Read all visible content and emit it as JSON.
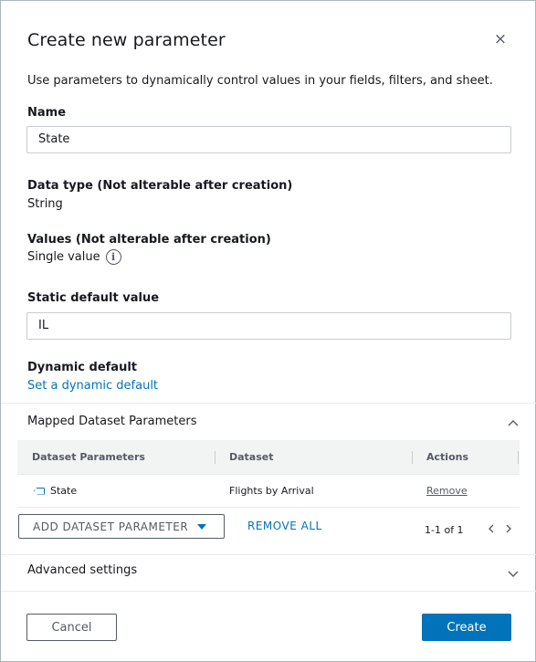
{
  "dialog": {
    "title": "Create new parameter",
    "close_symbol": "×",
    "description": "Use parameters to dynamically control values in your fields, filters, and sheet."
  },
  "name": {
    "label": "Name",
    "value": "State"
  },
  "data_type": {
    "label": "Data type (Not alterable after creation)",
    "value": "String"
  },
  "values": {
    "label": "Values (Not alterable after creation)",
    "value": "Single value",
    "info_icon": "info-icon"
  },
  "static_default": {
    "label": "Static default value",
    "value": "IL"
  },
  "dynamic_default": {
    "label": "Dynamic default",
    "link": "Set a dynamic default"
  },
  "mapped": {
    "title": "Mapped Dataset Parameters",
    "columns": [
      "Dataset Parameters",
      "Dataset",
      "Actions"
    ],
    "rows": [
      {
        "parameter": "State",
        "dataset": "Flights by Arrival",
        "action": "Remove"
      }
    ],
    "add_button": "ADD DATASET PARAMETER",
    "remove_all": "REMOVE ALL",
    "pagination": "1-1 of 1"
  },
  "advanced": {
    "title": "Advanced settings"
  },
  "footer": {
    "cancel": "Cancel",
    "create": "Create"
  },
  "colors": {
    "accent": "#0073bb",
    "text": "#16191f",
    "muted": "#545b64"
  }
}
